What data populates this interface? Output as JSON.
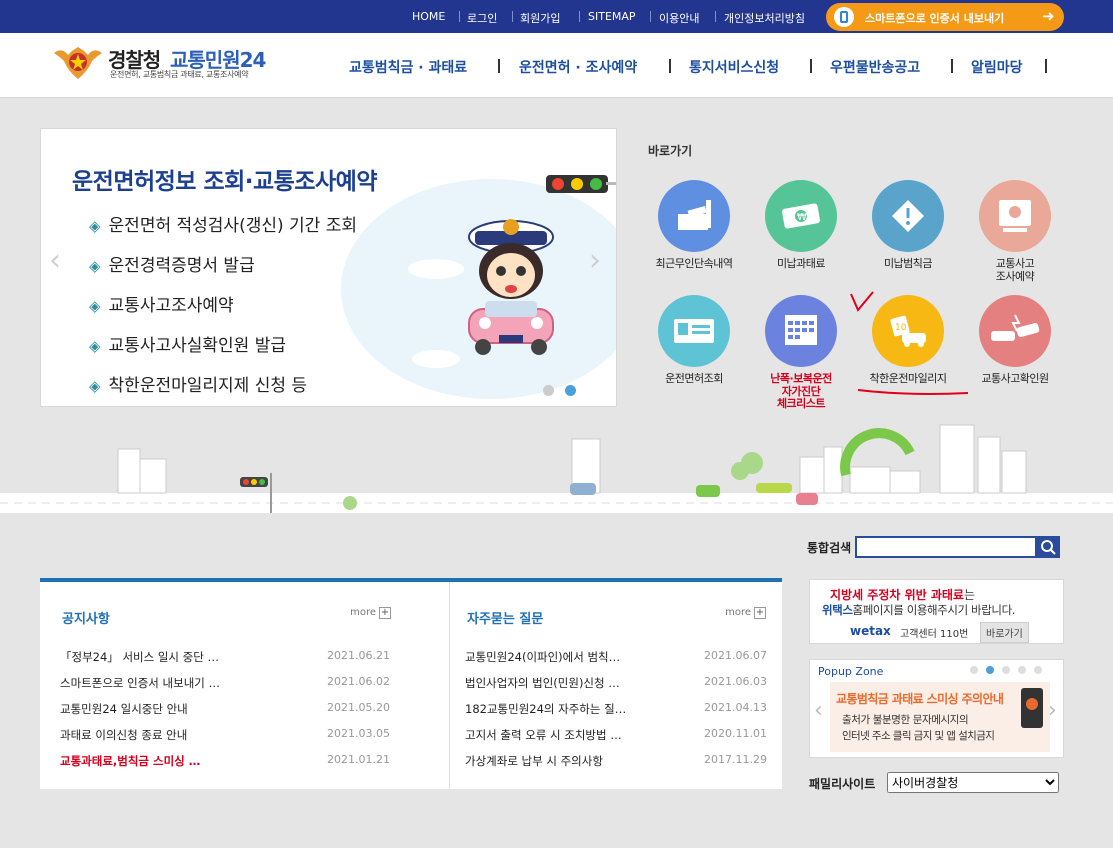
{
  "topbar": {
    "items": [
      "HOME",
      "로그인",
      "회원가입",
      "SITEMAP",
      "이용안내",
      "개인정보처리방침"
    ],
    "smart_label": "스마트폰으로 인증서 내보내기"
  },
  "header": {
    "logo_main": "경찰청",
    "logo_accent": "교통민원24",
    "logo_sub": "운전면허, 교통범칙금 과태료, 교통조사예약",
    "nav": [
      "교통범칙금 · 과태료",
      "운전면허 · 조사예약",
      "통지서비스신청",
      "우편물반송공고",
      "알림마당"
    ]
  },
  "slider": {
    "title": "운전면허정보 조회·교통조사예약",
    "items": [
      "운전면허 적성검사(갱신) 기간 조회",
      "운전경력증명서 발급",
      "교통사고조사예약",
      "교통사고사실확인원 발급",
      "착한운전마일리지제 신청 등"
    ]
  },
  "quick": {
    "title": "바로가기",
    "items": [
      {
        "label": "최근무인단속내역",
        "icon": "camera-icon",
        "color": "#5f8fe0"
      },
      {
        "label": "미납과태료",
        "icon": "money-icon",
        "color": "#55c496"
      },
      {
        "label": "미납범칙금",
        "icon": "warning-icon",
        "color": "#5aa4cc"
      },
      {
        "label": "교통사고\n조사예약",
        "icon": "computer-icon",
        "color": "#e9a898"
      },
      {
        "label": "운전면허조회",
        "icon": "id-card-icon",
        "color": "#5fc3d6"
      },
      {
        "label": "난폭·보복운전\n자가진단\n체크리스트",
        "icon": "calendar-icon",
        "color": "#6b82df",
        "highlight": true
      },
      {
        "label": "착한운전마일리지",
        "icon": "mileage-car-icon",
        "color": "#f7b813"
      },
      {
        "label": "교통사고확인원",
        "icon": "crash-icon",
        "color": "#e48080"
      }
    ]
  },
  "search": {
    "label": "통합검색",
    "value": ""
  },
  "notice": {
    "title": "공지사항",
    "more": "more",
    "rows": [
      {
        "title": "「정부24」 서비스 일시 중단 …",
        "date": "2021.06.21"
      },
      {
        "title": "스마트폰으로 인증서 내보내기 …",
        "date": "2021.06.02"
      },
      {
        "title": "교통민원24 일시중단 안내",
        "date": "2021.05.20"
      },
      {
        "title": "과태료 이의신청 종료 안내",
        "date": "2021.03.05"
      },
      {
        "title": "교통과태료,범칙금 스미싱 …",
        "date": "2021.01.21",
        "red": true
      }
    ]
  },
  "faq": {
    "title": "자주묻는 질문",
    "more": "more",
    "rows": [
      {
        "title": "교통민원24(이파인)에서 범칙…",
        "date": "2021.06.07"
      },
      {
        "title": "법인사업자의 법인(민원)신청 …",
        "date": "2021.06.03"
      },
      {
        "title": "182교통민원24의 자주하는 질…",
        "date": "2021.04.13"
      },
      {
        "title": "고지서 출력 오류 시 조치방법 …",
        "date": "2020.11.01"
      },
      {
        "title": "가상계좌로 납부 시 주의사항",
        "date": "2017.11.29"
      }
    ]
  },
  "wetax": {
    "line1a": "지방세 주정차 위반 과태료",
    "line1b": "는",
    "line2a": "위택스",
    "line2b": "홈페이지를 이용해주시기 바랍니다.",
    "logo": "wetax",
    "center": "고객센터 110번",
    "button": "바로가기"
  },
  "popup": {
    "title": "Popup Zone",
    "banner_title": "교통범칙금 과태료 스미싱 주의안내",
    "banner_l1": "출처가 불분명한 문자메시지의",
    "banner_l2": "인터넷 주소 클릭 금지 및 앱 설치금지"
  },
  "family": {
    "label": "패밀리사이트",
    "selected": "사이버경찰청"
  },
  "colors": {
    "primary": "#22358f",
    "accent": "#f49a17",
    "link": "#1e4ea0",
    "highlight": "#d4001e"
  }
}
